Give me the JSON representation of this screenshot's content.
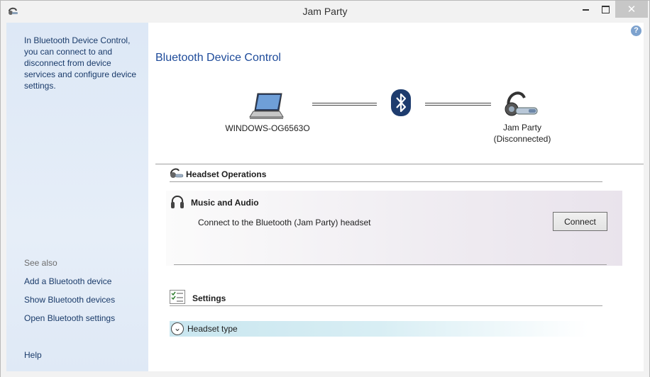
{
  "window": {
    "title": "Jam Party",
    "close_glyph": "✕"
  },
  "left_pane": {
    "description": "In Bluetooth Device Control, you can connect to and disconnect from device services and configure device settings.",
    "see_also": "See also",
    "links": [
      "Add a Bluetooth device",
      "Show Bluetooth devices",
      "Open Bluetooth settings"
    ],
    "help": "Help"
  },
  "main": {
    "help_glyph": "?",
    "title": "Bluetooth Device Control",
    "computer_name": "WINDOWS-OG6563O",
    "device_name": "Jam Party",
    "device_status": "(Disconnected)",
    "headset_operations": "Headset Operations",
    "music_audio": {
      "title": "Music and Audio",
      "description": "Connect to the Bluetooth (Jam Party) headset",
      "button": "Connect"
    },
    "settings": "Settings",
    "headset_type": "Headset type"
  },
  "colors": {
    "accent": "#1e4b9a",
    "link": "#1a3b6a",
    "left_pane_bg": "#dde8f6",
    "bluetooth": "#1e3c6e"
  },
  "icons": [
    "app-headset-icon",
    "minimize-icon",
    "maximize-icon",
    "close-icon",
    "help-icon",
    "laptop-icon",
    "bluetooth-icon",
    "headset-icon",
    "headphones-icon",
    "settings-list-icon",
    "expand-chevron-icon"
  ]
}
